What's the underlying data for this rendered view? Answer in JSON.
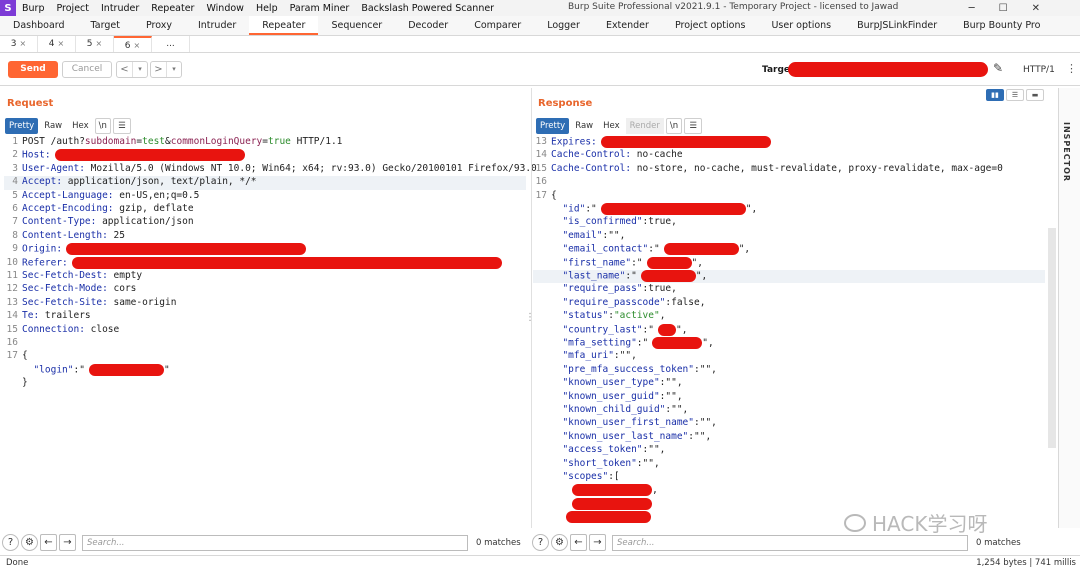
{
  "menubar": {
    "logo": "S",
    "items": [
      "Burp",
      "Project",
      "Intruder",
      "Repeater",
      "Window",
      "Help",
      "Param Miner",
      "Backslash Powered Scanner"
    ],
    "window_title": "Burp Suite Professional v2021.9.1 - Temporary Project - licensed to Jawad"
  },
  "tooltabs": [
    "Dashboard",
    "Target",
    "Proxy",
    "Intruder",
    "Repeater",
    "Sequencer",
    "Decoder",
    "Comparer",
    "Logger",
    "Extender",
    "Project options",
    "User options",
    "BurpJSLinkFinder",
    "Burp Bounty Pro"
  ],
  "active_tooltab": "Repeater",
  "subtabs": [
    {
      "label": "3",
      "close": "×"
    },
    {
      "label": "4",
      "close": "×"
    },
    {
      "label": "5",
      "close": "×"
    },
    {
      "label": "6",
      "close": "×"
    },
    {
      "label": "...",
      "close": ""
    }
  ],
  "toolbar": {
    "send_label": "Send",
    "cancel_label": "Cancel",
    "back_arrow": "<",
    "forward_arrow": ">",
    "dropdown": "▾",
    "target_label": "Target:",
    "protocol": "HTTP/1",
    "more": "⋮"
  },
  "request": {
    "title": "Request",
    "view_tabs": [
      "Pretty",
      "Raw",
      "Hex",
      "\\n",
      "☰"
    ],
    "lines": [
      {
        "n": "1",
        "parts": [
          [
            "POST /auth?",
            "hv"
          ],
          [
            "subdomain",
            "pn"
          ],
          [
            "=",
            "hv"
          ],
          [
            "test",
            "pv"
          ],
          [
            "&",
            "hv"
          ],
          [
            "commonLoginQuery",
            "pn"
          ],
          [
            "=",
            "hv"
          ],
          [
            "true",
            "pv"
          ],
          [
            " HTTP/1.1",
            "hv"
          ]
        ]
      },
      {
        "n": "2",
        "parts": [
          [
            "Host:",
            "hk"
          ]
        ],
        "redact": 190
      },
      {
        "n": "3",
        "parts": [
          [
            "User-Agent:",
            "hk"
          ],
          [
            " Mozilla/5.0 (Windows NT 10.0; Win64; x64; rv:93.0) Gecko/20100101 Firefox/93.0",
            "hv"
          ]
        ]
      },
      {
        "n": "4",
        "parts": [
          [
            "Accept:",
            "hk"
          ],
          [
            " application/json, text/plain, */*",
            "hv"
          ]
        ],
        "hl": true
      },
      {
        "n": "5",
        "parts": [
          [
            "Accept-Language:",
            "hk"
          ],
          [
            " en-US,en;q=0.5",
            "hv"
          ]
        ]
      },
      {
        "n": "6",
        "parts": [
          [
            "Accept-Encoding:",
            "hk"
          ],
          [
            " gzip, deflate",
            "hv"
          ]
        ]
      },
      {
        "n": "7",
        "parts": [
          [
            "Content-Type:",
            "hk"
          ],
          [
            " application/json",
            "hv"
          ]
        ]
      },
      {
        "n": "8",
        "parts": [
          [
            "Content-Length:",
            "hk"
          ],
          [
            " 25",
            "hv"
          ]
        ]
      },
      {
        "n": "9",
        "parts": [
          [
            "Origin:",
            "hk"
          ]
        ],
        "redact": 240
      },
      {
        "n": "10",
        "parts": [
          [
            "Referer:",
            "hk"
          ]
        ],
        "redact": 430
      },
      {
        "n": "11",
        "parts": [
          [
            "Sec-Fetch-Dest:",
            "hk"
          ],
          [
            " empty",
            "hv"
          ]
        ]
      },
      {
        "n": "12",
        "parts": [
          [
            "Sec-Fetch-Mode:",
            "hk"
          ],
          [
            " cors",
            "hv"
          ]
        ]
      },
      {
        "n": "13",
        "parts": [
          [
            "Sec-Fetch-Site:",
            "hk"
          ],
          [
            " same-origin",
            "hv"
          ]
        ]
      },
      {
        "n": "14",
        "parts": [
          [
            "Te:",
            "hk"
          ],
          [
            " trailers",
            "hv"
          ]
        ]
      },
      {
        "n": "15",
        "parts": [
          [
            "Connection:",
            "hk"
          ],
          [
            " close",
            "hv"
          ]
        ]
      },
      {
        "n": "16",
        "parts": []
      },
      {
        "n": "17",
        "parts": [
          [
            "{",
            "js-pun"
          ]
        ]
      },
      {
        "n": "",
        "parts": [
          [
            "  \"login\"",
            "js-key"
          ],
          [
            ":\"",
            "js-pun"
          ]
        ],
        "redact": 75,
        "after": [
          [
            "\"",
            "js-pun"
          ]
        ]
      },
      {
        "n": "",
        "parts": [
          [
            "}",
            "js-pun"
          ]
        ]
      }
    ],
    "search_placeholder": "Search...",
    "matches": "0 matches"
  },
  "response": {
    "title": "Response",
    "view_tabs": [
      "Pretty",
      "Raw",
      "Hex",
      "Render",
      "\\n",
      "☰"
    ],
    "lines": [
      {
        "n": "13",
        "parts": [
          [
            "Expires:",
            "hk"
          ]
        ],
        "redact": 170
      },
      {
        "n": "14",
        "parts": [
          [
            "Cache-Control:",
            "hk"
          ],
          [
            " no-cache",
            "hv"
          ]
        ]
      },
      {
        "n": "15",
        "parts": [
          [
            "Cache-Control:",
            "hk"
          ],
          [
            " no-store, no-cache, must-revalidate, proxy-revalidate, max-age=0",
            "hv"
          ]
        ]
      },
      {
        "n": "16",
        "parts": []
      },
      {
        "n": "17",
        "parts": [
          [
            "{",
            "js-pun"
          ]
        ]
      },
      {
        "n": "",
        "parts": [
          [
            "  \"id\"",
            "js-key"
          ],
          [
            ":\"",
            "js-pun"
          ]
        ],
        "redact": 145,
        "after": [
          [
            "\",",
            "js-pun"
          ]
        ]
      },
      {
        "n": "",
        "parts": [
          [
            "  \"is_confirmed\"",
            "js-key"
          ],
          [
            ":true,",
            "js-pun"
          ]
        ]
      },
      {
        "n": "",
        "parts": [
          [
            "  \"email\"",
            "js-key"
          ],
          [
            ":\"\",",
            "js-pun"
          ]
        ]
      },
      {
        "n": "",
        "parts": [
          [
            "  \"email_contact\"",
            "js-key"
          ],
          [
            ":\"",
            "js-pun"
          ]
        ],
        "redact": 75,
        "after": [
          [
            "\",",
            "js-pun"
          ]
        ]
      },
      {
        "n": "",
        "parts": [
          [
            "  \"first_name\"",
            "js-key"
          ],
          [
            ":\"",
            "js-pun"
          ]
        ],
        "redact": 45,
        "after": [
          [
            "\",",
            "js-pun"
          ]
        ]
      },
      {
        "n": "",
        "parts": [
          [
            "  \"last_name\"",
            "js-key"
          ],
          [
            ":\"",
            "js-pun"
          ]
        ],
        "redact": 55,
        "after": [
          [
            "\",",
            "js-pun"
          ]
        ],
        "hl": true
      },
      {
        "n": "",
        "parts": [
          [
            "  \"require_pass\"",
            "js-key"
          ],
          [
            ":true,",
            "js-pun"
          ]
        ]
      },
      {
        "n": "",
        "parts": [
          [
            "  \"require_passcode\"",
            "js-key"
          ],
          [
            ":false,",
            "js-pun"
          ]
        ]
      },
      {
        "n": "",
        "parts": [
          [
            "  \"status\"",
            "js-key"
          ],
          [
            ":",
            "js-pun"
          ],
          [
            "\"active\"",
            "js-str"
          ],
          [
            ",",
            "js-pun"
          ]
        ]
      },
      {
        "n": "",
        "parts": [
          [
            "  \"country_last\"",
            "js-key"
          ],
          [
            ":\"",
            "js-pun"
          ]
        ],
        "redact": 18,
        "after": [
          [
            "\",",
            "js-pun"
          ]
        ]
      },
      {
        "n": "",
        "parts": [
          [
            "  \"mfa_setting\"",
            "js-key"
          ],
          [
            ":\"",
            "js-pun"
          ]
        ],
        "redact": 50,
        "after": [
          [
            "\",",
            "js-pun"
          ]
        ]
      },
      {
        "n": "",
        "parts": [
          [
            "  \"mfa_uri\"",
            "js-key"
          ],
          [
            ":\"\",",
            "js-pun"
          ]
        ]
      },
      {
        "n": "",
        "parts": [
          [
            "  \"pre_mfa_success_token\"",
            "js-key"
          ],
          [
            ":\"\",",
            "js-pun"
          ]
        ]
      },
      {
        "n": "",
        "parts": [
          [
            "  \"known_user_type\"",
            "js-key"
          ],
          [
            ":\"\",",
            "js-pun"
          ]
        ]
      },
      {
        "n": "",
        "parts": [
          [
            "  \"known_user_guid\"",
            "js-key"
          ],
          [
            ":\"\",",
            "js-pun"
          ]
        ]
      },
      {
        "n": "",
        "parts": [
          [
            "  \"known_child_guid\"",
            "js-key"
          ],
          [
            ":\"\",",
            "js-pun"
          ]
        ]
      },
      {
        "n": "",
        "parts": [
          [
            "  \"known_user_first_name\"",
            "js-key"
          ],
          [
            ":\"\",",
            "js-pun"
          ]
        ]
      },
      {
        "n": "",
        "parts": [
          [
            "  \"known_user_last_name\"",
            "js-key"
          ],
          [
            ":\"\",",
            "js-pun"
          ]
        ]
      },
      {
        "n": "",
        "parts": [
          [
            "  \"access_token\"",
            "js-key"
          ],
          [
            ":\"\",",
            "js-pun"
          ]
        ]
      },
      {
        "n": "",
        "parts": [
          [
            "  \"short_token\"",
            "js-key"
          ],
          [
            ":\"\",",
            "js-pun"
          ]
        ]
      },
      {
        "n": "",
        "parts": [
          [
            "  \"scopes\"",
            "js-key"
          ],
          [
            ":[",
            "js-pun"
          ]
        ]
      },
      {
        "n": "",
        "parts": [
          [
            "   ",
            "js-pun"
          ]
        ],
        "redact": 80,
        "after": [
          [
            ",",
            "js-pun"
          ]
        ]
      },
      {
        "n": "",
        "parts": [
          [
            "   ",
            "js-pun"
          ]
        ],
        "redact": 80
      },
      {
        "n": "",
        "parts": [
          [
            "  ",
            "js-pun"
          ]
        ],
        "redact": 85
      }
    ],
    "search_placeholder": "Search...",
    "matches": "0 matches"
  },
  "inspector_label": "INSPECTOR",
  "status": {
    "left": "Done",
    "right": "1,254 bytes | 741 millis"
  },
  "watermark": "HACK学习呀",
  "colors": {
    "accent": "#ff6633",
    "active_blue": "#2e6db4",
    "redaction": "#e8140f"
  }
}
